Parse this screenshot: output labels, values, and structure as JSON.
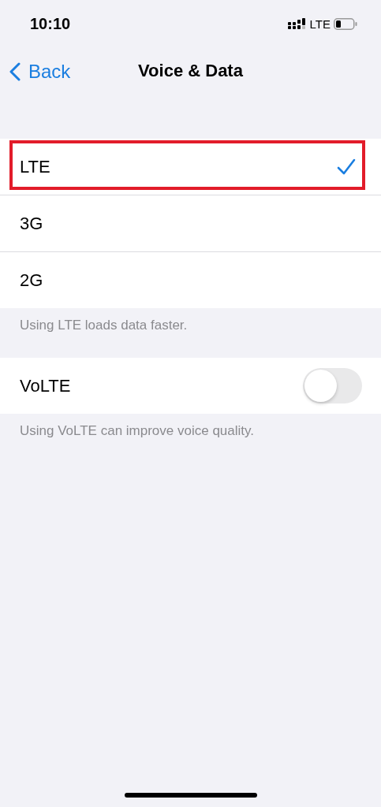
{
  "status_bar": {
    "time": "10:10",
    "network": "LTE"
  },
  "nav": {
    "back": "Back",
    "title": "Voice & Data"
  },
  "options": [
    {
      "label": "LTE",
      "selected": true,
      "highlighted": true
    },
    {
      "label": "3G",
      "selected": false,
      "highlighted": false
    },
    {
      "label": "2G",
      "selected": false,
      "highlighted": false
    }
  ],
  "options_footer": "Using LTE loads data faster.",
  "toggles": [
    {
      "label": "VoLTE",
      "on": false
    }
  ],
  "toggles_footer": "Using VoLTE can improve voice quality."
}
